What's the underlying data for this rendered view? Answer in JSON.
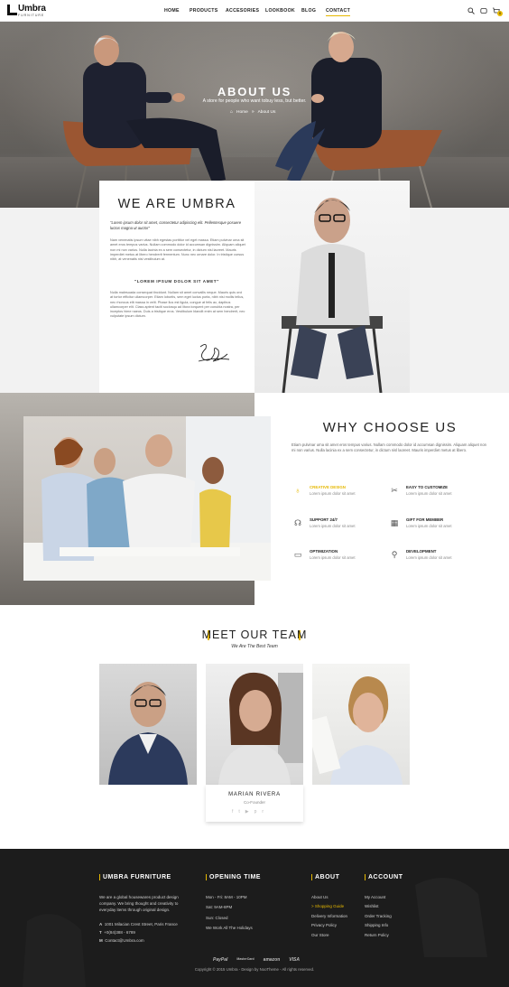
{
  "header": {
    "logo_text": "Umbra",
    "logo_sub": "FURNITURE",
    "nav": [
      "HOME",
      "PRODUCTS",
      "ACCESORIES",
      "LOOKBOOK",
      "BLOG",
      "CONTACT"
    ],
    "active_nav": "CONTACT",
    "cart_count": "0"
  },
  "hero": {
    "title": "ABOUT US",
    "subtitle": "A store for people who want tobuy less, but better.",
    "breadcrumb_home": "Home",
    "breadcrumb_current": "About Us"
  },
  "about": {
    "title": "WE ARE UMBRA",
    "lead_quote": "\"Lorem ipsum dolor sit amet, consectetur adipiscing elit. Pellentesque posuere luctus magna ut auctor\"",
    "para1": "Nam venenatis ipsum vitae nibh egestas porttitor vel eget massa. Etiam pulvinar urna sit amet eros tempus varius. Nullam commodo dolor id accumsan dignissim. Aliquam aliquet non mi non varius. Nulla lacinia ex a sem consectetur, in dictum nisl laoreet. Mauris imperdiet metus at libero hendrerit fermentum. Nunc nec ornare dolor. In tristique cursus nibh, at venenatis nisl vestibulum at.",
    "pull_quote": "\"LOREM IPSUM DOLOR SIT AMET\"",
    "para2": "Nulla malesuada consequat tincidunt. Nullam sit amet convallis neque. Mauris quis orci at tortor efficitur ullamcorper. Etiam lobortis, sem eget luctus porta, nibh nisi mollis tellus, nec rhoncus elit massa in velit. Phase llus est ligula, congue at felis ac, dapibus ullamcorper elit. Class aptent taciti sociosqu ad litora torquent per conubia nostra, per inceptos hime naeos. Duis a tristique eros. Vestibulum blandit enim at sem hendrerit, nec vulputate ipsum dictum."
  },
  "why": {
    "title": "WHY CHOOSE US",
    "intro": "Etiam pulvinar urna sit amet eros tempus varius. Nullam commodo dolor id accumsan dignissim. Aliquam aliquet non mi non varius. Nulla lacinia ex a sem consectetur, in dictum nisl laoreet. Mauris imperdiet metus at libero.",
    "features": [
      {
        "title": "CREATIVE DESIGN",
        "desc": "Lorem ipsum dolor sit amet",
        "icon": "lightbulb-icon"
      },
      {
        "title": "EASY TO CUSTOMIZE",
        "desc": "Lorem ipsum dolor sit amet",
        "icon": "tools-icon"
      },
      {
        "title": "SUPPORT 24/7",
        "desc": "Lorem ipsum dolor sit amet",
        "icon": "headset-icon"
      },
      {
        "title": "GIFT FOR MEMBER",
        "desc": "Lorem ipsum dolor sit amet",
        "icon": "gift-icon"
      },
      {
        "title": "OPTIMIZATION",
        "desc": "Lorem ipsum dolor sit amet",
        "icon": "monitor-icon"
      },
      {
        "title": "DEVELOPMENT",
        "desc": "Lorem ipsum dolor sit amet",
        "icon": "brush-icon"
      }
    ],
    "highlight_color": "#e6b800"
  },
  "team": {
    "title": "MEET OUR TEAM",
    "subtitle": "We Are The Best Team",
    "featured_name": "MARIAN RIVERA",
    "featured_role": "Co-Founder"
  },
  "footer": {
    "col1_title": "UMBRA FURNITURE",
    "col1_text": [
      "We are a global housewares product design",
      "company. We bring thought and creativity to",
      "everyday items through original design."
    ],
    "address": "1001 Milacian Crest Street, Paris France",
    "phone": "+0(84)388 - 6789",
    "email": "Contact@Umbra.com",
    "addr_label": "A",
    "phone_label": "T",
    "email_label": "M",
    "col2_title": "OPENING TIME",
    "hours": [
      "Mon - Fri: 8AM - 10PM",
      "Sat: 9AM-8PM",
      "Sun: Closed",
      "We Work All The Holidays"
    ],
    "col3_title": "ABOUT",
    "about_links": [
      "About Us",
      "> Shopping Guide",
      "Delivery Information",
      "Privacy Policy",
      "Our Store"
    ],
    "col4_title": "ACCOUNT",
    "account_links": [
      "My Account",
      "Wishlist",
      "Order Tracking",
      "Shipping Info",
      "Return Policy"
    ],
    "payments": [
      "PayPal",
      "MasterCard",
      "amazon",
      "VISA"
    ],
    "copyright": "Copyright © 2015 Umbra - Design by NooTheme - All rights reserved."
  }
}
